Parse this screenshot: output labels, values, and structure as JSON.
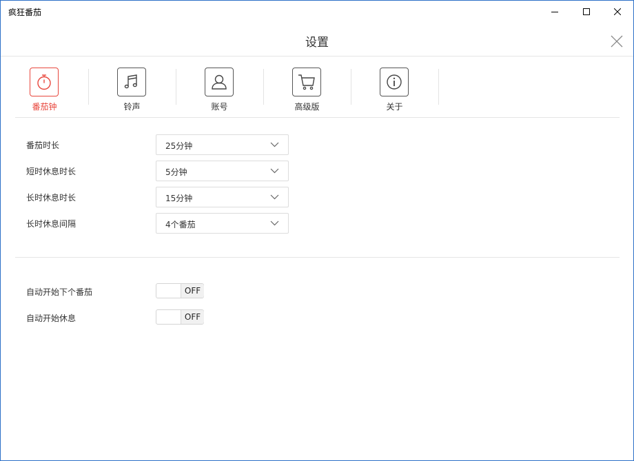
{
  "window": {
    "title": "疯狂番茄"
  },
  "dialog": {
    "title": "设置"
  },
  "tabs": [
    {
      "label": "番茄钟",
      "icon": "stopwatch-icon",
      "active": true
    },
    {
      "label": "铃声",
      "icon": "music-note-icon",
      "active": false
    },
    {
      "label": "账号",
      "icon": "user-icon",
      "active": false
    },
    {
      "label": "高级版",
      "icon": "cart-icon",
      "active": false
    },
    {
      "label": "关于",
      "icon": "info-icon",
      "active": false
    }
  ],
  "durations": [
    {
      "label": "番茄时长",
      "value": "25分钟"
    },
    {
      "label": "短时休息时长",
      "value": "5分钟"
    },
    {
      "label": "长时休息时长",
      "value": "15分钟"
    },
    {
      "label": "长时休息间隔",
      "value": "4个番茄"
    }
  ],
  "toggles": [
    {
      "label": "自动开始下个番茄",
      "state": "OFF"
    },
    {
      "label": "自动开始休息",
      "state": "OFF"
    }
  ],
  "colors": {
    "accent": "#e8463c",
    "window_border": "#2b6fc7"
  }
}
